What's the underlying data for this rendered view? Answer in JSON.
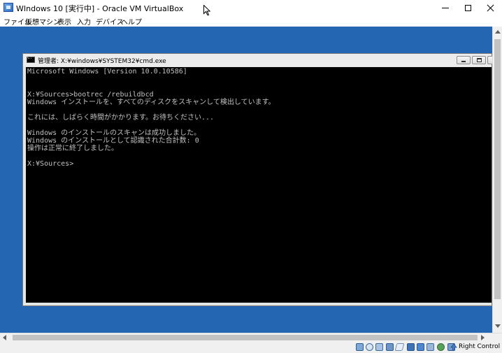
{
  "window": {
    "title": "WIndows 10 [実行中] - Oracle VM VirtualBox"
  },
  "menu": {
    "items": [
      "ファイル",
      "仮想マシン",
      "表示",
      "入力",
      "デバイス",
      "ヘルプ"
    ]
  },
  "cmd": {
    "title": "管理者: X:¥windows¥SYSTEM32¥cmd.exe",
    "lines": [
      "Microsoft Windows [Version 10.0.10586]",
      "",
      "",
      "X:¥Sources>bootrec /rebuildbcd",
      "Windows インストールを、すべてのディスクをスキャンして検出しています。",
      "",
      "これには、しばらく時間がかかります。お待ちください...",
      "",
      "Windows のインストールのスキャンは成功しました。",
      "Windows のインストールとして認識された合計数: 0",
      "操作は正常に終了しました。",
      "",
      "X:¥Sources>"
    ]
  },
  "statusbar": {
    "host_key": "Right Control",
    "icons": [
      "hard-disk-icon",
      "optical-drive-icon",
      "audio-icon",
      "network-icon",
      "usb-icon",
      "shared-folders-icon",
      "display-icon",
      "video-capture-icon",
      "vt-x-icon",
      "mouse-integration-icon",
      "keyboard-capture-icon"
    ]
  },
  "colors": {
    "guest_desktop": "#2566b3",
    "console_bg": "#000000",
    "console_text": "#c0c0c0"
  }
}
